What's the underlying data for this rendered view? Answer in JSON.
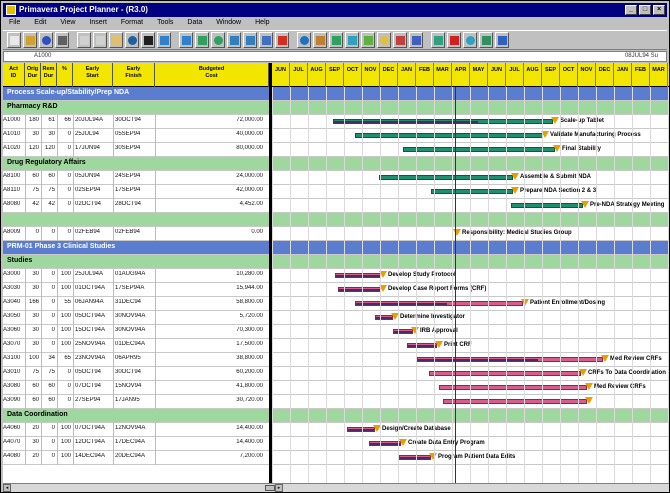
{
  "title": "Primavera Project Planner - (R3.0)",
  "window_buttons": [
    "_",
    "□",
    "×"
  ],
  "menu": [
    "File",
    "Edit",
    "View",
    "Insert",
    "Format",
    "Tools",
    "Data",
    "Window",
    "Help"
  ],
  "toolbar_icons": [
    "new-icon",
    "open-icon",
    "save-icon",
    "print-icon",
    "cut-icon",
    "copy-icon",
    "paste-icon",
    "find-icon",
    "binoculars-icon",
    "link-icon",
    "unlink-icon",
    "filter-icon",
    "organize-icon",
    "zoom-in-icon",
    "zoom-out-icon",
    "schedule-icon",
    "level-icon",
    "chart-icon",
    "resource-icon",
    "target-icon",
    "calendar-icon",
    "barchart-icon",
    "network-icon",
    "report-icon",
    "help-icon",
    "arrow-icon",
    "stop-icon",
    "wizard-icon",
    "check-icon",
    "dice-icon"
  ],
  "toolbar_colors": [
    "#e8e8e8",
    "#d0a030",
    "#3050c0",
    "#606060",
    "#d0d0d0",
    "#d0d0d0",
    "#e0c070",
    "#2060a0",
    "#202020",
    "#3080d0",
    "#3080d0",
    "#30a060",
    "#30a060",
    "#3080c0",
    "#3080c0",
    "#4070c0",
    "#d03020",
    "#2070c0",
    "#c08030",
    "#30a060",
    "#30a0c0",
    "#60b040",
    "#e0c040",
    "#c04040",
    "#4060c0",
    "#30a080",
    "#d02020",
    "#30a0c0",
    "#309060",
    "#3060c0"
  ],
  "formula": {
    "cell": "A1000",
    "value": "08JUL94 Su"
  },
  "columns": [
    {
      "label": "Act\nID"
    },
    {
      "label": "Orig\nDur"
    },
    {
      "label": "Rem\nDur"
    },
    {
      "label": "%"
    },
    {
      "label": "Early\nStart"
    },
    {
      "label": "Early\nFinish"
    },
    {
      "label": "Budgeted\nCost"
    }
  ],
  "months": [
    "JUN",
    "JUL",
    "AUG",
    "SEP",
    "OCT",
    "NOV",
    "DEC",
    "JAN",
    "FEB",
    "MAR",
    "APR",
    "MAY",
    "JUN",
    "JUL",
    "AUG",
    "SEP",
    "OCT",
    "NOV",
    "DEC",
    "JAN",
    "FEB",
    "MAR"
  ],
  "rows": [
    {
      "type": "project",
      "label": "Process Scale-up/Stability/Prep NDA"
    },
    {
      "type": "group",
      "label": "Pharmacy R&D"
    },
    {
      "type": "task",
      "id": "A1000",
      "od": "180",
      "rd": "61",
      "pct": "66",
      "es": "20JUL94A",
      "ef": "30OCT94",
      "cost": "72,000.00",
      "color": "green",
      "bar": [
        330,
        550
      ],
      "label": "Scale-up Tablet"
    },
    {
      "type": "task",
      "id": "A1010",
      "od": "30",
      "rd": "30",
      "pct": "0",
      "es": "25JUL94",
      "ef": "05SEP94",
      "cost": "40,000.00",
      "color": "green",
      "bar": [
        352,
        540
      ],
      "label": "Validate Manufacturing Process"
    },
    {
      "type": "task",
      "id": "A1020",
      "od": "120",
      "rd": "120",
      "pct": "0",
      "es": "17JUN94",
      "ef": "30SEP94",
      "cost": "80,000.00",
      "color": "green",
      "bar": [
        400,
        552
      ],
      "label": "Final Stability"
    },
    {
      "type": "group",
      "label": "Drug Regulatory Affairs"
    },
    {
      "type": "task",
      "id": "A8100",
      "od": "60",
      "rd": "60",
      "pct": "0",
      "es": "05JUN94",
      "ef": "24SEP94",
      "cost": "24,000.00",
      "color": "green",
      "bar": [
        376,
        510
      ],
      "label": "Assemble & Submit NDA"
    },
    {
      "type": "task",
      "id": "A8110",
      "od": "75",
      "rd": "75",
      "pct": "0",
      "es": "02SEP94",
      "ef": "17SEP94",
      "cost": "42,000.00",
      "color": "green",
      "bar": [
        428,
        510
      ],
      "label": "Prepare NDA Section 2 & 3"
    },
    {
      "type": "task",
      "id": "A8080",
      "od": "42",
      "rd": "42",
      "pct": "0",
      "es": "02OCT94",
      "ef": "28OCT94",
      "cost": "4,452.00",
      "color": "green",
      "bar": [
        508,
        580
      ],
      "label": "Pre-NDA Strategy Meeting"
    },
    {
      "type": "group",
      "label": ""
    },
    {
      "type": "task",
      "id": "A8009",
      "od": "0",
      "rd": "0",
      "pct": "0",
      "es": "02FEB94",
      "ef": "02FEB94",
      "cost": "0.00",
      "color": "none",
      "bar": [
        452,
        452
      ],
      "label": "Responsibility: Medical Studies Group"
    },
    {
      "type": "project",
      "label": "PRM-01 Phase 3 Clinical Studies"
    },
    {
      "type": "group",
      "label": "Studies"
    },
    {
      "type": "task",
      "id": "A3000",
      "od": "30",
      "rd": "0",
      "pct": "100",
      "es": "25JUL94A",
      "ef": "01AUG94A",
      "cost": "10,280.00",
      "color": "pink",
      "bar": [
        332,
        378
      ],
      "label": "Develop Study Protocol"
    },
    {
      "type": "task",
      "id": "A3030",
      "od": "30",
      "rd": "0",
      "pct": "100",
      "es": "01OCT94A",
      "ef": "17SEP94A",
      "cost": "15,944.00",
      "color": "pink",
      "bar": [
        335,
        378
      ],
      "label": "Develop Case Report Forms (CRF)"
    },
    {
      "type": "task",
      "id": "A3040",
      "od": "166",
      "rd": "0",
      "pct": "55",
      "es": "06JAN94A",
      "ef": "31DEC94",
      "cost": "58,800.00",
      "color": "pink",
      "bar": [
        352,
        520
      ],
      "label": "Patient Enrollment/Dosing"
    },
    {
      "type": "task",
      "id": "A3050",
      "od": "30",
      "rd": "0",
      "pct": "100",
      "es": "05OCT94A",
      "ef": "30NOV94A",
      "cost": "5,720.00",
      "color": "pink",
      "bar": [
        372,
        390
      ],
      "label": "Determine Investigator"
    },
    {
      "type": "task",
      "id": "A3060",
      "od": "30",
      "rd": "0",
      "pct": "100",
      "es": "15OCT94A",
      "ef": "30NOV94A",
      "cost": "70,300.00",
      "color": "pink",
      "bar": [
        390,
        410
      ],
      "label": "IRB Approval"
    },
    {
      "type": "task",
      "id": "A3070",
      "od": "30",
      "rd": "0",
      "pct": "100",
      "es": "25NOV94A",
      "ef": "01DEC94A",
      "cost": "17,500.00",
      "color": "pink",
      "bar": [
        404,
        434
      ],
      "label": "Print CRF"
    },
    {
      "type": "task",
      "id": "A3100",
      "od": "100",
      "rd": "34",
      "pct": "65",
      "es": "23NOV94A",
      "ef": "06APR95",
      "cost": "38,800.00",
      "color": "pink",
      "bar": [
        414,
        600
      ],
      "label": "Med Review CRFs"
    },
    {
      "type": "task",
      "id": "A3010",
      "od": "75",
      "rd": "75",
      "pct": "0",
      "es": "05OCT94",
      "ef": "30OCT94",
      "cost": "60,200.00",
      "color": "pink",
      "bar": [
        426,
        578
      ],
      "label": "CRFs To Data Coordination"
    },
    {
      "type": "task",
      "id": "A3080",
      "od": "60",
      "rd": "60",
      "pct": "0",
      "es": "07OCT94",
      "ef": "15NOV94",
      "cost": "41,800.00",
      "color": "pink",
      "bar": [
        436,
        584
      ],
      "label": "Med Review CRFs"
    },
    {
      "type": "task",
      "id": "A3090",
      "od": "60",
      "rd": "60",
      "pct": "0",
      "es": "27SEP94",
      "ef": "17JAN95",
      "cost": "30,720.00",
      "color": "pink",
      "bar": [
        440,
        584
      ],
      "label": ""
    },
    {
      "type": "group",
      "label": "Data Coordination"
    },
    {
      "type": "task",
      "id": "A4060",
      "od": "20",
      "rd": "0",
      "pct": "100",
      "es": "07OCT94A",
      "ef": "12NOV94A",
      "cost": "14,400.00",
      "color": "pink",
      "bar": [
        344,
        372
      ],
      "label": "Design/Create Database"
    },
    {
      "type": "task",
      "id": "A4070",
      "od": "30",
      "rd": "0",
      "pct": "100",
      "es": "12OCT94A",
      "ef": "17DEC94A",
      "cost": "14,400.00",
      "color": "pink",
      "bar": [
        366,
        398
      ],
      "label": "Create Data Entry Program"
    },
    {
      "type": "task",
      "id": "A4080",
      "od": "20",
      "rd": "0",
      "pct": "100",
      "es": "14DEC94A",
      "ef": "20DEC94A",
      "cost": "7,200.00",
      "color": "pink",
      "bar": [
        396,
        428
      ],
      "label": "Program Patient Data Edits"
    }
  ]
}
